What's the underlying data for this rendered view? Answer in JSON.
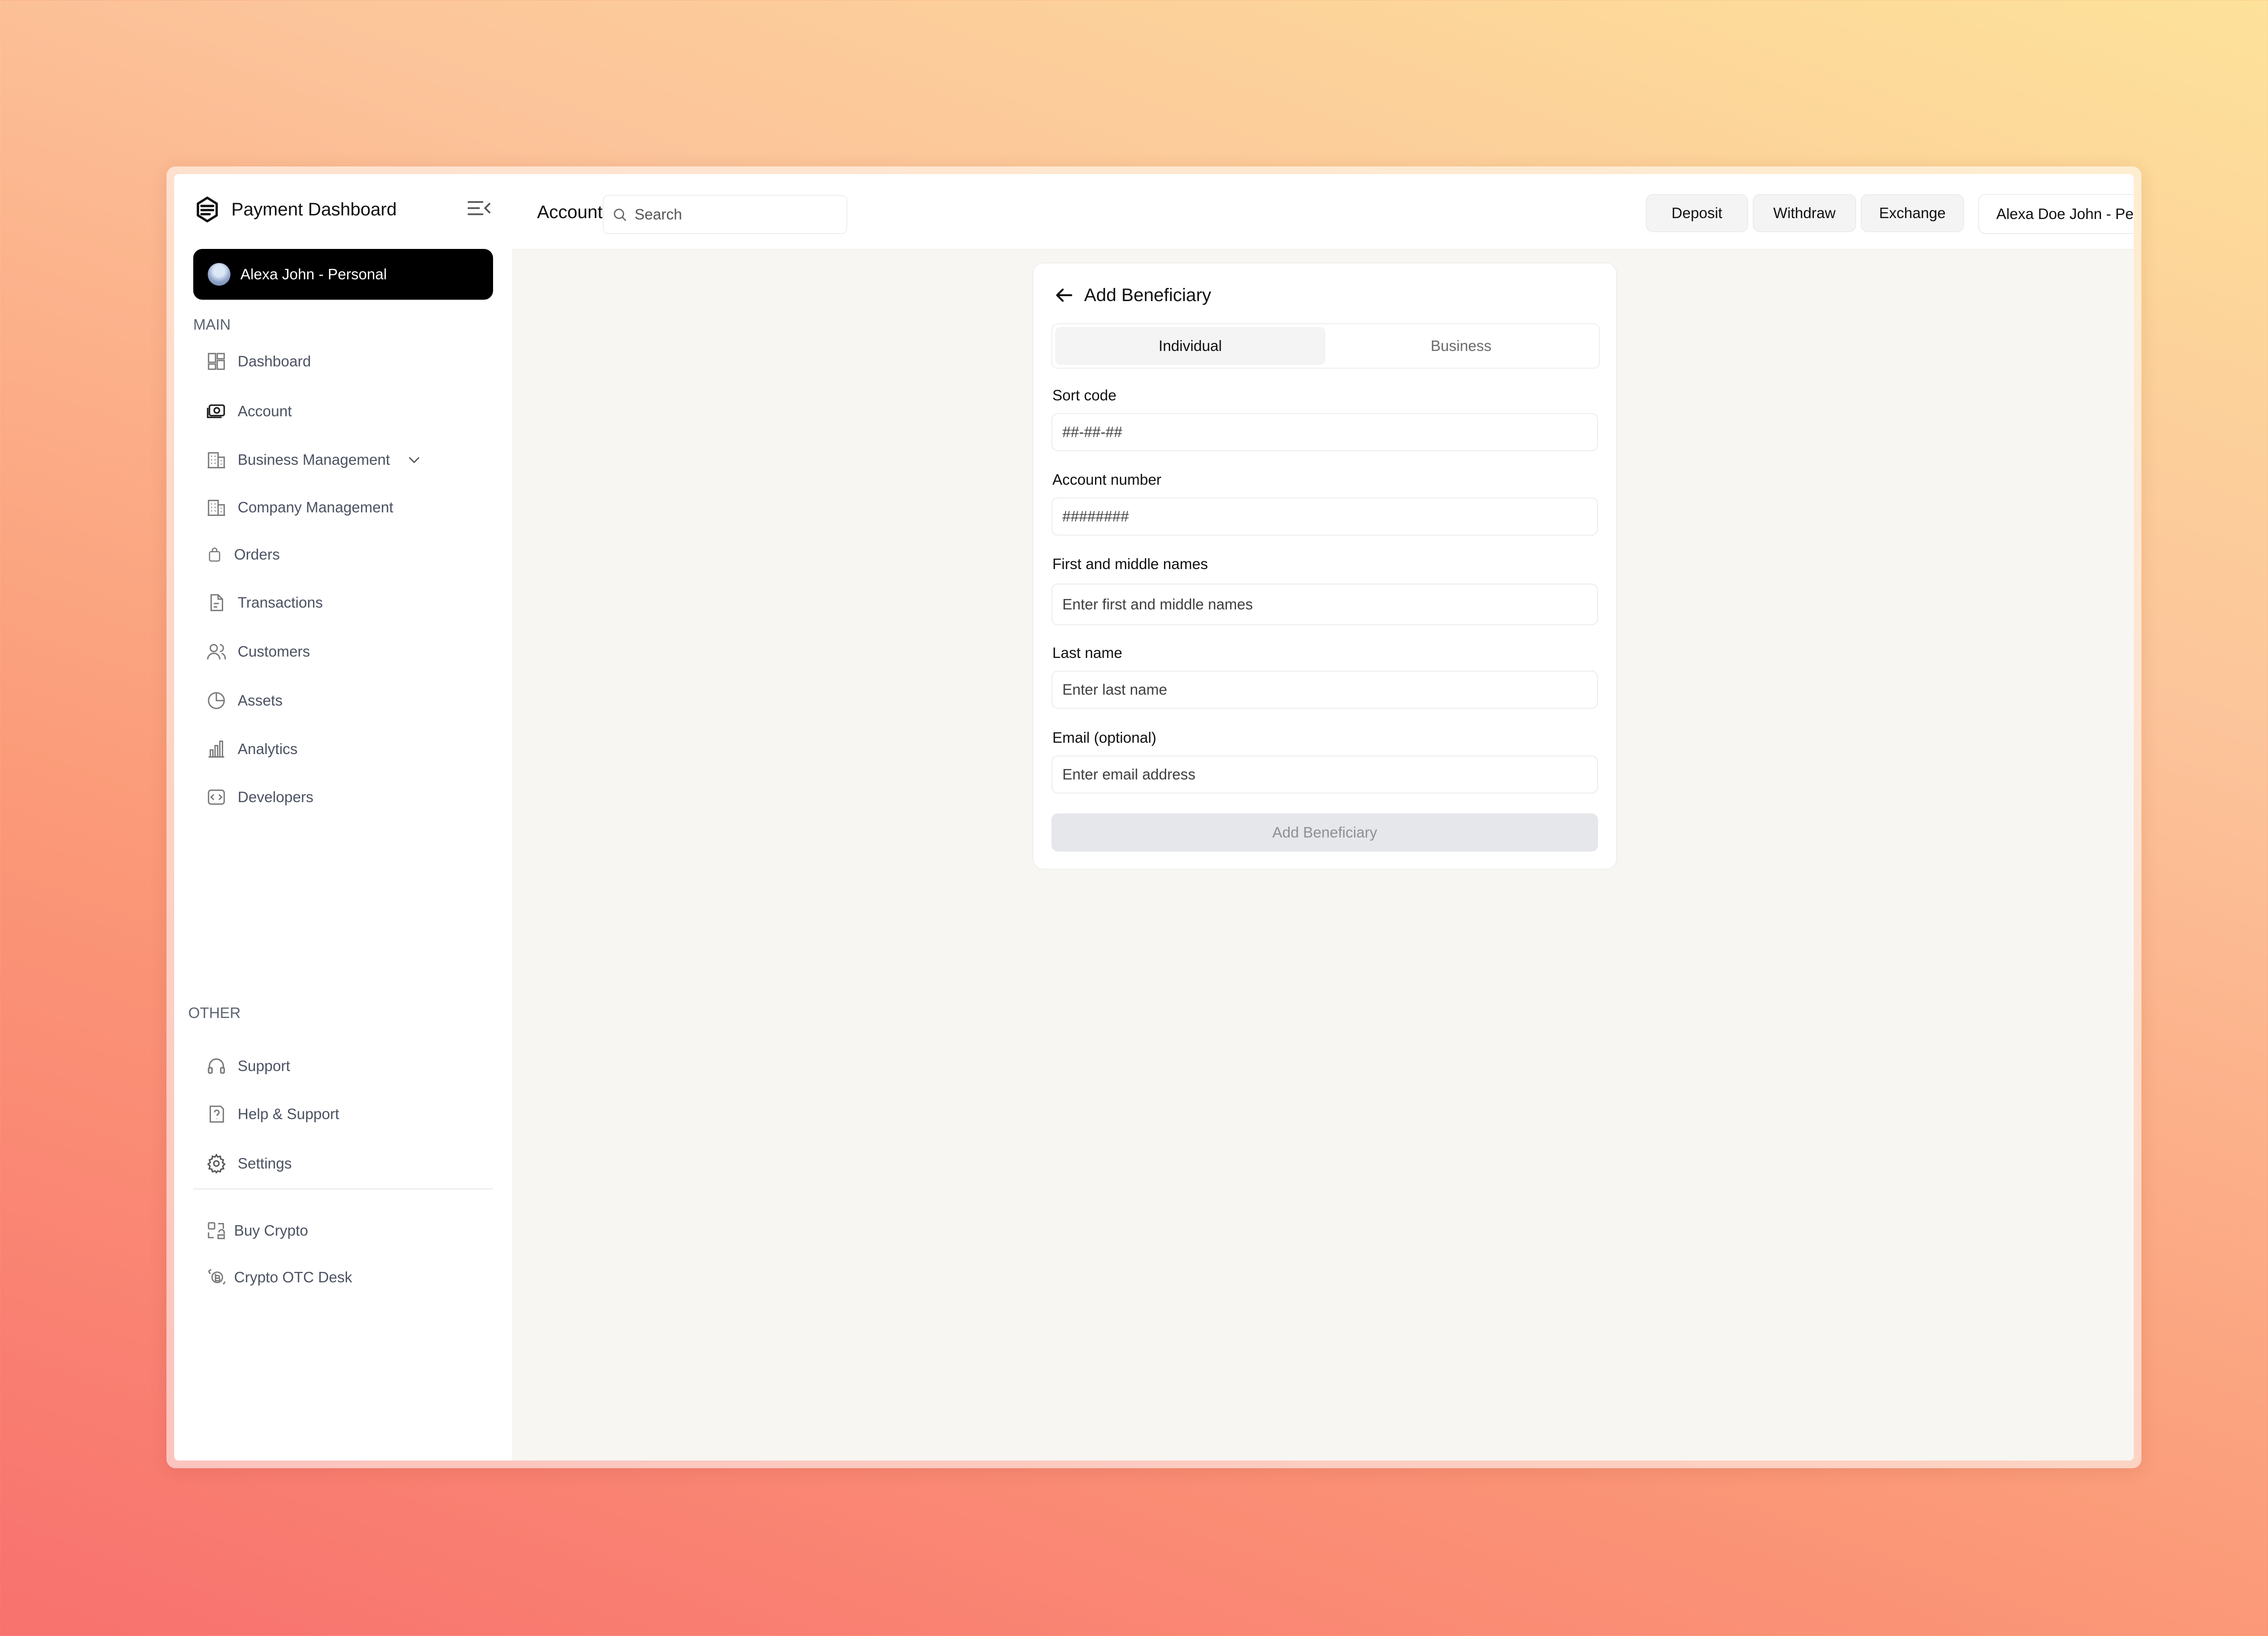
{
  "sidebar": {
    "brand_title": "Payment Dashboard",
    "account_name": "Alexa John - Personal",
    "section_main": "MAIN",
    "section_other": "OTHER",
    "items": [
      {
        "label": "Dashboard",
        "icon": "dashboard-icon"
      },
      {
        "label": "Account",
        "icon": "account-icon"
      },
      {
        "label": "Business Management",
        "icon": "building-icon",
        "has_dropdown": true
      },
      {
        "label": "Company Management",
        "icon": "building-icon"
      },
      {
        "label": "Orders",
        "icon": "bag-icon"
      },
      {
        "label": "Transactions",
        "icon": "document-icon"
      },
      {
        "label": "Customers",
        "icon": "users-icon"
      },
      {
        "label": "Assets",
        "icon": "pie-icon"
      },
      {
        "label": "Analytics",
        "icon": "bar-chart-icon"
      },
      {
        "label": "Developers",
        "icon": "code-icon"
      }
    ],
    "other_items": [
      {
        "label": "Support",
        "icon": "headset-icon"
      },
      {
        "label": "Help & Support",
        "icon": "help-icon"
      },
      {
        "label": "Settings",
        "icon": "gear-icon"
      }
    ],
    "extra_items": [
      {
        "label": "Buy Crypto",
        "icon": "crypto-icon"
      },
      {
        "label": "Crypto OTC Desk",
        "icon": "otc-icon"
      }
    ]
  },
  "topbar": {
    "page_title": "Accounts",
    "search_placeholder": "Search",
    "deposit_label": "Deposit",
    "withdraw_label": "Withdraw",
    "exchange_label": "Exchange",
    "profile_label": "Alexa Doe John - Personal"
  },
  "form": {
    "title": "Add Beneficiary",
    "tabs": [
      "Individual",
      "Business"
    ],
    "active_tab": "Individual",
    "sort_code": {
      "label": "Sort code",
      "placeholder": "##-##-##",
      "value": ""
    },
    "account_number": {
      "label": "Account number",
      "placeholder": "########",
      "value": ""
    },
    "first_names": {
      "label": "First and middle names",
      "placeholder": "Enter first and middle names",
      "value": ""
    },
    "last_name": {
      "label": "Last name",
      "placeholder": "Enter last name",
      "value": ""
    },
    "email": {
      "label": "Email (optional)",
      "placeholder": "Enter email address",
      "value": ""
    },
    "submit_label": "Add Beneficiary"
  },
  "colors": {
    "accent": "#000000",
    "disabled_button_bg": "#e6e7ea",
    "main_bg": "#f7f6f3"
  }
}
